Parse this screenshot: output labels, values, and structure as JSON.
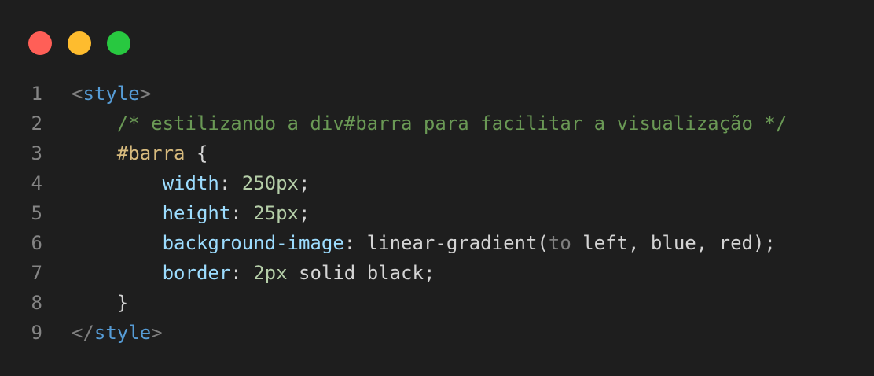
{
  "colors": {
    "background": "#1e1e1e",
    "close": "#ff5f57",
    "minimize": "#febc2e",
    "maximize": "#28c840",
    "line_number": "#858585",
    "punctuation": "#808080",
    "tag": "#569cd6",
    "comment": "#6a9955",
    "selector": "#d7ba7d",
    "property": "#9cdcfe",
    "number": "#b5cea8",
    "plain": "#d4d4d4"
  },
  "editor": {
    "line_numbers": [
      "1",
      "2",
      "3",
      "4",
      "5",
      "6",
      "7",
      "8",
      "9"
    ],
    "lines": [
      [
        {
          "t": "<",
          "k": "punctuation"
        },
        {
          "t": "style",
          "k": "tag"
        },
        {
          "t": ">",
          "k": "punctuation"
        }
      ],
      [
        {
          "t": "    ",
          "k": "plain"
        },
        {
          "t": "/* estilizando a div#barra para facilitar a visualização */",
          "k": "comment"
        }
      ],
      [
        {
          "t": "    ",
          "k": "plain"
        },
        {
          "t": "#barra",
          "k": "selector"
        },
        {
          "t": " {",
          "k": "plain"
        }
      ],
      [
        {
          "t": "        ",
          "k": "plain"
        },
        {
          "t": "width",
          "k": "property"
        },
        {
          "t": ": ",
          "k": "plain"
        },
        {
          "t": "250px",
          "k": "number"
        },
        {
          "t": ";",
          "k": "plain"
        }
      ],
      [
        {
          "t": "        ",
          "k": "plain"
        },
        {
          "t": "height",
          "k": "property"
        },
        {
          "t": ": ",
          "k": "plain"
        },
        {
          "t": "25px",
          "k": "number"
        },
        {
          "t": ";",
          "k": "plain"
        }
      ],
      [
        {
          "t": "        ",
          "k": "plain"
        },
        {
          "t": "background-image",
          "k": "property"
        },
        {
          "t": ": linear-gradient(",
          "k": "plain"
        },
        {
          "t": "to",
          "k": "punctuation"
        },
        {
          "t": " left, blue, red);",
          "k": "plain"
        }
      ],
      [
        {
          "t": "        ",
          "k": "plain"
        },
        {
          "t": "border",
          "k": "property"
        },
        {
          "t": ": ",
          "k": "plain"
        },
        {
          "t": "2px",
          "k": "number"
        },
        {
          "t": " solid black;",
          "k": "plain"
        }
      ],
      [
        {
          "t": "    }",
          "k": "plain"
        }
      ],
      [
        {
          "t": "</",
          "k": "punctuation"
        },
        {
          "t": "style",
          "k": "tag"
        },
        {
          "t": ">",
          "k": "punctuation"
        }
      ]
    ]
  }
}
